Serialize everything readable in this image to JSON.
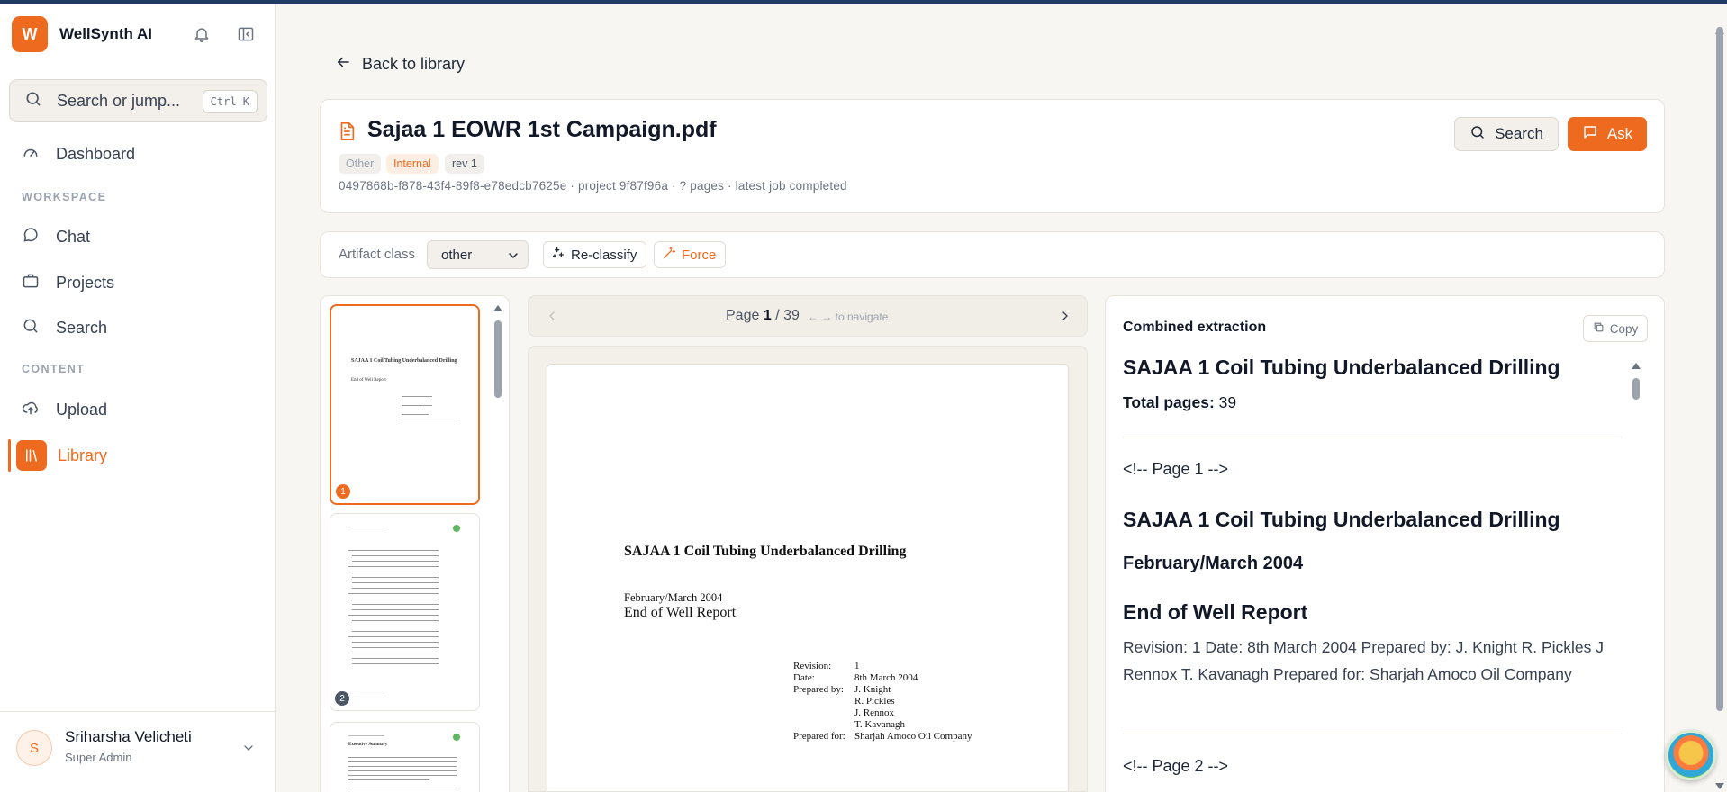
{
  "app": {
    "name": "WellSynth AI",
    "logo_letter": "W"
  },
  "colors": {
    "accent": "#ee6a1f",
    "topbar": "#1f3b63"
  },
  "sidebar": {
    "search": {
      "placeholder": "Search or jump...",
      "shortcut": "Ctrl K"
    },
    "dashboard": "Dashboard",
    "workspace_heading": "WORKSPACE",
    "workspace_items": [
      "Chat",
      "Projects",
      "Search"
    ],
    "content_heading": "CONTENT",
    "content_items": [
      "Upload",
      "Library"
    ],
    "active_item": "Library",
    "user": {
      "initial": "S",
      "name": "Sriharsha Velicheti",
      "role": "Super Admin"
    }
  },
  "main": {
    "back_label": "Back to library",
    "doc": {
      "title": "Sajaa 1 EOWR 1st Campaign.pdf",
      "tags": [
        "Other",
        "Internal",
        "rev 1"
      ],
      "meta": "0497868b-f878-43f4-89f8-e78edcb7625e · project 9f87f96a · ? pages · latest job completed",
      "search_label": "Search",
      "ask_label": "Ask"
    },
    "artifact": {
      "label": "Artifact class",
      "selected": "other",
      "reclassify_label": "Re-classify",
      "force_label": "Force"
    },
    "thumbnails": [
      {
        "number": "1",
        "title": "SAJAA 1 Coil Tubing Underbalanced Drilling",
        "subtitle": "End of Well Report",
        "selected": true
      },
      {
        "number": "2",
        "title": "",
        "subtitle": "",
        "selected": false
      },
      {
        "number": "3",
        "title": "Executive Summary",
        "subtitle": "",
        "selected": false
      }
    ],
    "pager": {
      "label": "Page",
      "current": "1",
      "total": "39",
      "hint": "← → to navigate"
    },
    "page": {
      "title": "SAJAA 1 Coil Tubing Underbalanced Drilling",
      "date": "February/March 2004",
      "report": "End of Well Report",
      "fields": [
        {
          "key": "Revision:",
          "val": "1"
        },
        {
          "key": "Date:",
          "val": "8th March 2004"
        },
        {
          "key": "Prepared by:",
          "val": "J. Knight"
        },
        {
          "key": "",
          "val": "R. Pickles"
        },
        {
          "key": "",
          "val": "J. Rennox"
        },
        {
          "key": "",
          "val": "T. Kavanagh"
        },
        {
          "key": "Prepared for:",
          "val": "Sharjah Amoco Oil Company"
        }
      ]
    },
    "extraction": {
      "heading": "Combined extraction",
      "copy_label": "Copy",
      "title": "SAJAA 1 Coil Tubing Underbalanced Drilling",
      "total_pages_label": "Total pages:",
      "total_pages_value": "39",
      "page1_marker": "<!-- Page 1 -->",
      "page1_title": "SAJAA 1 Coil Tubing Underbalanced Drilling",
      "page1_date": "February/March 2004",
      "page1_report": "End of Well Report",
      "page1_text": "Revision: 1 Date: 8th March 2004 Prepared by: J. Knight R. Pickles J Rennox T. Kavanagh Prepared for: Sharjah Amoco Oil Company",
      "page2_marker": "<!-- Page 2 -->"
    }
  }
}
